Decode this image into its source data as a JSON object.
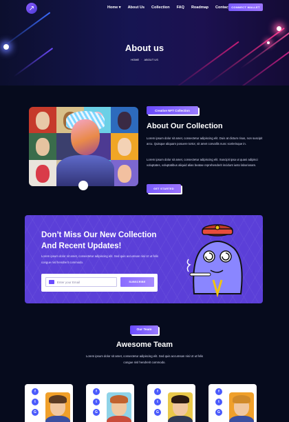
{
  "nav": {
    "items": [
      {
        "label": "Home ▾"
      },
      {
        "label": "About Us"
      },
      {
        "label": "Collection"
      },
      {
        "label": "FAQ"
      },
      {
        "label": "Roadmap"
      },
      {
        "label": "Contact"
      }
    ],
    "connect_label": "CONNECT WALLET"
  },
  "hero": {
    "title": "About us",
    "breadcrumb_home": "HOME",
    "breadcrumb_sep": "·",
    "breadcrumb_current": "ABOUT US"
  },
  "about": {
    "pill": "Creative NFT Collection",
    "title": "About Our Collection",
    "p1": "Lorem ipsum dolor sit amet, consectetur adipiscing elit. Duis at dictum risus, non suscipit arcu. Quisque aliquam posuere tortor, sit amet convallis nunc scelerisque in.",
    "p2": "Lorem ipsum dolor sit amet, consectetur adipiscing elit. Suscipit ipsa ut quasi adipisci voluptates, voluptatibus aliquid alias beatae reprehenderit incidunt iusto laboriosam.",
    "button": "GET STARTED"
  },
  "newsletter": {
    "title_line1": "Don’t Miss Our New Collection",
    "title_line2": "And Recent Updates!",
    "text": "Lorem ipsum dolor sit amet, consectetur adipiscing elit. Sed quis accumsan nisi Ut ut felis congue nisl hendrerit commodo.",
    "email_placeholder": "Enter your Email",
    "subscribe": "SUBSCRIBE"
  },
  "team": {
    "pill": "Our Team",
    "title": "Awesome Team",
    "text": "Lorem ipsum dolor sit amet, consectetur adipiscing elit. Sed quis accumsan nisi Ut ut felis congue nisl hendrerit commodo.",
    "social": [
      "f",
      "t",
      "G"
    ]
  },
  "colors": {
    "accent": "#7a5cff",
    "newsletter_bg": "#5b3fd8",
    "page_bg": "#060b1d",
    "hero_pink": "#ff2f8a",
    "social_blue": "#4a5afc"
  },
  "icons": [
    "logo-arrow-icon",
    "envelope-icon",
    "facebook-icon",
    "twitter-icon",
    "google-icon",
    "chevron-down-icon"
  ]
}
